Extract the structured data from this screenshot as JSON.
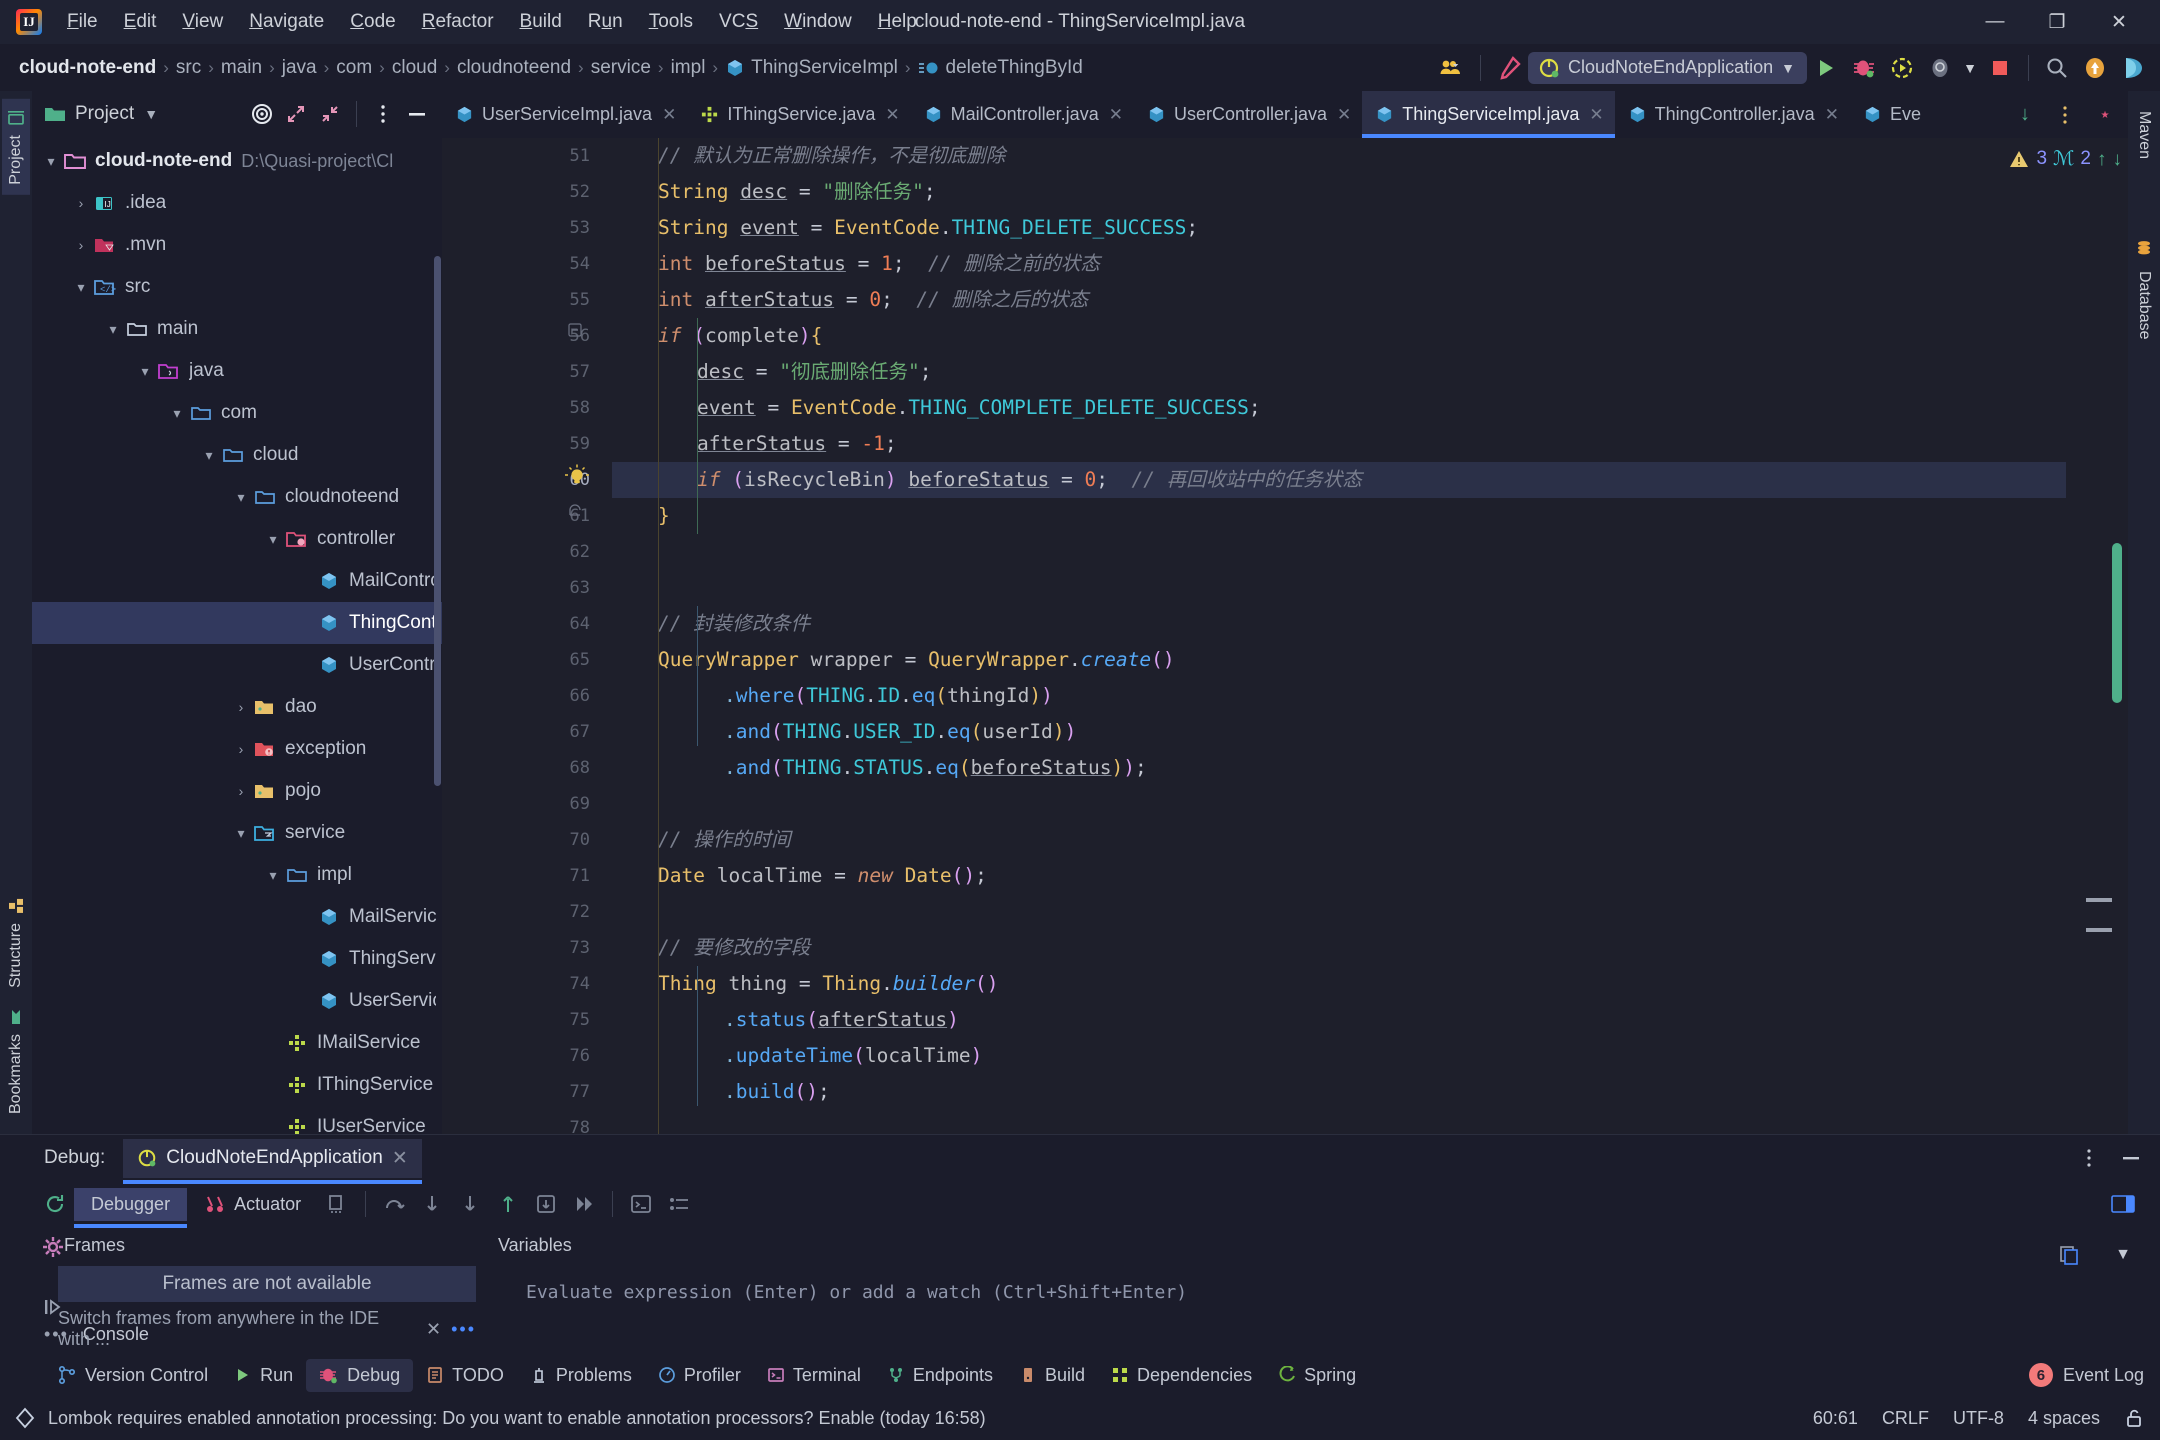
{
  "window": {
    "title": "cloud-note-end - ThingServiceImpl.java",
    "minimize": "—",
    "maximize": "❐",
    "close": "✕"
  },
  "menubar": {
    "items": [
      "File",
      "Edit",
      "View",
      "Navigate",
      "Code",
      "Refactor",
      "Build",
      "Run",
      "Tools",
      "VCS",
      "Window",
      "Help"
    ]
  },
  "breadcrumb": {
    "items": [
      {
        "label": "cloud-note-end",
        "icon": "",
        "root": true
      },
      {
        "label": "src",
        "icon": ""
      },
      {
        "label": "main",
        "icon": ""
      },
      {
        "label": "java",
        "icon": ""
      },
      {
        "label": "com",
        "icon": ""
      },
      {
        "label": "cloud",
        "icon": ""
      },
      {
        "label": "cloudnoteend",
        "icon": ""
      },
      {
        "label": "service",
        "icon": ""
      },
      {
        "label": "impl",
        "icon": ""
      },
      {
        "label": "ThingServiceImpl",
        "icon": "class-icon"
      },
      {
        "label": "deleteThingById",
        "icon": "method-icon"
      }
    ]
  },
  "toolbar": {
    "run_config": "CloudNoteEndApplication",
    "icons": [
      "users-icon",
      "hammer-icon",
      "run-icon",
      "debug-icon",
      "run-with-coverage-icon",
      "profiler-icon",
      "stop-icon",
      "search-icon",
      "update-icon",
      "ai-assistant-icon"
    ]
  },
  "project_panel": {
    "title": "Project",
    "header_icons": [
      "target-icon",
      "expand-icon",
      "collapse-icon",
      "more-icon",
      "hide-icon"
    ],
    "tree": [
      {
        "label": "cloud-note-end",
        "path": "D:\\Quasi-project\\Cl",
        "depth": 0,
        "chevron": "down",
        "icon": "module-folder-icon",
        "bold": true
      },
      {
        "label": ".idea",
        "depth": 1,
        "chevron": "right",
        "icon": "idea-folder-icon"
      },
      {
        "label": ".mvn",
        "depth": 1,
        "chevron": "right",
        "icon": "maven-folder-icon"
      },
      {
        "label": "src",
        "depth": 1,
        "chevron": "down",
        "icon": "source-root-icon"
      },
      {
        "label": "main",
        "depth": 2,
        "chevron": "down",
        "icon": "folder-icon"
      },
      {
        "label": "java",
        "depth": 3,
        "chevron": "down",
        "icon": "java-source-icon"
      },
      {
        "label": "com",
        "depth": 4,
        "chevron": "down",
        "icon": "folder-icon"
      },
      {
        "label": "cloud",
        "depth": 5,
        "chevron": "down",
        "icon": "folder-icon"
      },
      {
        "label": "cloudnoteend",
        "depth": 6,
        "chevron": "down",
        "icon": "folder-icon"
      },
      {
        "label": "controller",
        "depth": 7,
        "chevron": "down",
        "icon": "controller-folder-icon"
      },
      {
        "label": "MailController",
        "depth": 8,
        "chevron": "none",
        "icon": "class-icon"
      },
      {
        "label": "ThingController",
        "depth": 8,
        "chevron": "none",
        "icon": "class-icon",
        "selected": true
      },
      {
        "label": "UserController",
        "depth": 8,
        "chevron": "none",
        "icon": "class-icon"
      },
      {
        "label": "dao",
        "depth": 7,
        "chevron": "right",
        "icon": "dao-folder-icon"
      },
      {
        "label": "exception",
        "depth": 7,
        "chevron": "right",
        "icon": "exception-folder-icon"
      },
      {
        "label": "pojo",
        "depth": 7,
        "chevron": "right",
        "icon": "dao-folder-icon"
      },
      {
        "label": "service",
        "depth": 7,
        "chevron": "down",
        "icon": "service-folder-icon"
      },
      {
        "label": "impl",
        "depth": 8,
        "chevron": "down",
        "icon": "folder-icon"
      },
      {
        "label": "MailServiceImpl",
        "depth": 9,
        "chevron": "none",
        "icon": "class-icon"
      },
      {
        "label": "ThingServiceImpl",
        "depth": 9,
        "chevron": "none",
        "icon": "class-icon"
      },
      {
        "label": "UserServiceImpl",
        "depth": 9,
        "chevron": "none",
        "icon": "class-icon"
      },
      {
        "label": "IMailService",
        "depth": 8,
        "chevron": "none",
        "icon": "interface-icon"
      },
      {
        "label": "IThingService",
        "depth": 8,
        "chevron": "none",
        "icon": "interface-icon"
      },
      {
        "label": "IUserService",
        "depth": 8,
        "chevron": "none",
        "icon": "interface-icon"
      }
    ]
  },
  "editor_tabs": [
    {
      "label": "UserServiceImpl.java",
      "icon": "class-icon",
      "active": false
    },
    {
      "label": "IThingService.java",
      "icon": "interface-icon",
      "active": false
    },
    {
      "label": "MailController.java",
      "icon": "class-icon",
      "active": false
    },
    {
      "label": "UserController.java",
      "icon": "class-icon",
      "active": false
    },
    {
      "label": "ThingServiceImpl.java",
      "icon": "class-icon",
      "active": true
    },
    {
      "label": "ThingController.java",
      "icon": "class-icon",
      "active": false
    },
    {
      "label": "Eve",
      "icon": "class-icon",
      "active": false
    }
  ],
  "inspections": {
    "warnings": "3",
    "typos": "2",
    "prev": "↑",
    "next": "↓"
  },
  "code": {
    "first_line": 51,
    "current_line": 60,
    "lines": [
      {
        "n": 51,
        "html": "<span class=\"cm\">// 默认为正常删除操作，不是彻底删除</span>",
        "indent": 1
      },
      {
        "n": 52,
        "html": "<span class=\"ty\">String</span> <span class=\"idu\">desc</span> = <span class=\"str\">\"删除任务\"</span>;",
        "indent": 1
      },
      {
        "n": 53,
        "html": "<span class=\"ty\">String</span> <span class=\"idu\">event</span> = <span class=\"ty\">EventCode</span>.<span class=\"cst\">THING_DELETE_SUCCESS</span>;",
        "indent": 1
      },
      {
        "n": 54,
        "html": "<span class=\"k\">int</span> <span class=\"idu\">beforeStatus</span> = <span class=\"num\">1</span>;  <span class=\"cm\">// 删除之前的状态</span>",
        "indent": 1
      },
      {
        "n": 55,
        "html": "<span class=\"k\">int</span> <span class=\"idu\">afterStatus</span> = <span class=\"num\">0</span>;  <span class=\"cm\">// 删除之后的状态</span>",
        "indent": 1
      },
      {
        "n": 56,
        "html": "<span class=\"k\" style=\"font-style:italic\">if</span> <span class=\"pr1\">(</span><span class=\"id\">complete</span><span class=\"pr1\">)</span><span class=\"pr2\">{</span>",
        "indent": 1,
        "fold": "open"
      },
      {
        "n": 57,
        "html": "<span class=\"idu\">desc</span> = <span class=\"str\">\"彻底删除任务\"</span>;",
        "indent": 2
      },
      {
        "n": 58,
        "html": "<span class=\"idu\">event</span> = <span class=\"ty\">EventCode</span>.<span class=\"cst\">THING_COMPLETE_DELETE_SUCCESS</span>;",
        "indent": 2
      },
      {
        "n": 59,
        "html": "<span class=\"idu\">afterStatus</span> = <span class=\"num\">-1</span>;",
        "indent": 2
      },
      {
        "n": 60,
        "html": "<span class=\"k\" style=\"font-style:italic\">if</span> <span class=\"pr1\">(</span><span class=\"id\">isRecycleBin</span><span class=\"pr1\">)</span> <span class=\"idu\">beforeStatus</span> = <span class=\"num\">0</span>;  <span class=\"cm\">// 再回收站中的任务状态</span>",
        "indent": 2,
        "highlight": true,
        "bulb": true
      },
      {
        "n": 61,
        "html": "<span class=\"pr2\">}</span>",
        "indent": 1,
        "fold": "close"
      },
      {
        "n": 62,
        "html": "",
        "indent": 0
      },
      {
        "n": 63,
        "html": "",
        "indent": 0
      },
      {
        "n": 64,
        "html": "<span class=\"cm\">// 封装修改条件</span>",
        "indent": 1
      },
      {
        "n": 65,
        "html": "<span class=\"ty\">QueryWrapper</span> <span class=\"id\">wrapper</span> = <span class=\"ty\">QueryWrapper</span>.<span class=\"mthi\">create</span><span class=\"pr1\">()</span>",
        "indent": 1
      },
      {
        "n": 66,
        "html": "<span class=\"pr3\">.</span><span class=\"mth\">where</span><span class=\"pr1\">(</span><span class=\"cst\">THING</span>.<span class=\"cst\">ID</span>.<span class=\"mth\">eq</span><span class=\"pr2\">(</span><span class=\"id\">thingId</span><span class=\"pr2\">)</span><span class=\"pr1\">)</span>",
        "indent": 3
      },
      {
        "n": 67,
        "html": "<span class=\"pr3\">.</span><span class=\"mth\">and</span><span class=\"pr1\">(</span><span class=\"cst\">THING</span>.<span class=\"cst\">USER_ID</span>.<span class=\"mth\">eq</span><span class=\"pr2\">(</span><span class=\"id\">userId</span><span class=\"pr2\">)</span><span class=\"pr1\">)</span>",
        "indent": 3
      },
      {
        "n": 68,
        "html": "<span class=\"pr3\">.</span><span class=\"mth\">and</span><span class=\"pr1\">(</span><span class=\"cst\">THING</span>.<span class=\"cst\">STATUS</span>.<span class=\"mth\">eq</span><span class=\"pr2\">(</span><span class=\"idu\">beforeStatus</span><span class=\"pr2\">)</span><span class=\"pr1\">)</span>;",
        "indent": 3
      },
      {
        "n": 69,
        "html": "",
        "indent": 0
      },
      {
        "n": 70,
        "html": "<span class=\"cm\">// 操作的时间</span>",
        "indent": 1
      },
      {
        "n": 71,
        "html": "<span class=\"ty\">Date</span> <span class=\"id\">localTime</span> = <span class=\"k\" style=\"font-style:italic\">new</span> <span class=\"ty\">Date</span><span class=\"pr1\">()</span>;",
        "indent": 1
      },
      {
        "n": 72,
        "html": "",
        "indent": 0
      },
      {
        "n": 73,
        "html": "<span class=\"cm\">// 要修改的字段</span>",
        "indent": 1
      },
      {
        "n": 74,
        "html": "<span class=\"ty\">Thing</span> <span class=\"id\">thing</span> = <span class=\"ty\">Thing</span>.<span class=\"mthi\">builder</span><span class=\"pr1\">()</span>",
        "indent": 1
      },
      {
        "n": 75,
        "html": "<span class=\"pr3\">.</span><span class=\"mth\">status</span><span class=\"pr1\">(</span><span class=\"idu\">afterStatus</span><span class=\"pr1\">)</span>",
        "indent": 3
      },
      {
        "n": 76,
        "html": "<span class=\"pr3\">.</span><span class=\"mth\">updateTime</span><span class=\"pr1\">(</span><span class=\"id\">localTime</span><span class=\"pr1\">)</span>",
        "indent": 3
      },
      {
        "n": 77,
        "html": "<span class=\"pr3\">.</span><span class=\"mth\">build</span><span class=\"pr1\">()</span>;",
        "indent": 3
      },
      {
        "n": 78,
        "html": "",
        "indent": 0
      }
    ]
  },
  "left_tools": [
    {
      "label": "Project",
      "icon": "project-icon",
      "active": true
    },
    {
      "label": "Structure",
      "icon": "structure-icon",
      "active": false
    },
    {
      "label": "Bookmarks",
      "icon": "bookmarks-icon",
      "active": false
    }
  ],
  "right_tools": [
    {
      "label": "Maven",
      "icon": "maven-icon"
    },
    {
      "label": "Database",
      "icon": "database-icon"
    }
  ],
  "debug_panel": {
    "label": "Debug:",
    "session_tab": "CloudNoteEndApplication",
    "tabs": [
      {
        "label": "Debugger",
        "active": true,
        "icon": ""
      },
      {
        "label": "Actuator",
        "active": false,
        "icon": "actuator-icon"
      }
    ],
    "frames_header": "Frames",
    "variables_header": "Variables",
    "frames_message": "Frames are not available",
    "frames_hint": "Switch frames from anywhere in the IDE with ...",
    "variables_hint": "Evaluate expression (Enter) or add a watch (Ctrl+Shift+Enter)",
    "console_label": "Console"
  },
  "toolwindow_bar": {
    "items": [
      {
        "label": "Version Control",
        "icon": "vcs-icon",
        "active": false
      },
      {
        "label": "Run",
        "icon": "run-icon",
        "active": false
      },
      {
        "label": "Debug",
        "icon": "debug-icon",
        "active": true
      },
      {
        "label": "TODO",
        "icon": "todo-icon",
        "active": false
      },
      {
        "label": "Problems",
        "icon": "problems-icon",
        "active": false
      },
      {
        "label": "Profiler",
        "icon": "profiler-icon",
        "active": false
      },
      {
        "label": "Terminal",
        "icon": "terminal-icon",
        "active": false
      },
      {
        "label": "Endpoints",
        "icon": "endpoints-icon",
        "active": false
      },
      {
        "label": "Build",
        "icon": "build-icon",
        "active": false
      },
      {
        "label": "Dependencies",
        "icon": "dependencies-icon",
        "active": false
      },
      {
        "label": "Spring",
        "icon": "spring-icon",
        "active": false
      }
    ],
    "event_log": {
      "label": "Event Log",
      "count": "6"
    }
  },
  "statusbar": {
    "message": "Lombok requires enabled annotation processing: Do you want to enable annotation processors? Enable (today 16:58)",
    "caret": "60:61",
    "line_separator": "CRLF",
    "encoding": "UTF-8",
    "indent": "4 spaces",
    "lock": "unlocked-icon"
  },
  "colors": {
    "accent": "#4a88ff",
    "selection": "#32395e",
    "editor_bg": "#1e1f2b",
    "panel_bg": "#1b1c2b",
    "warning": "#e8bf6a",
    "error": "#f27a7a"
  }
}
